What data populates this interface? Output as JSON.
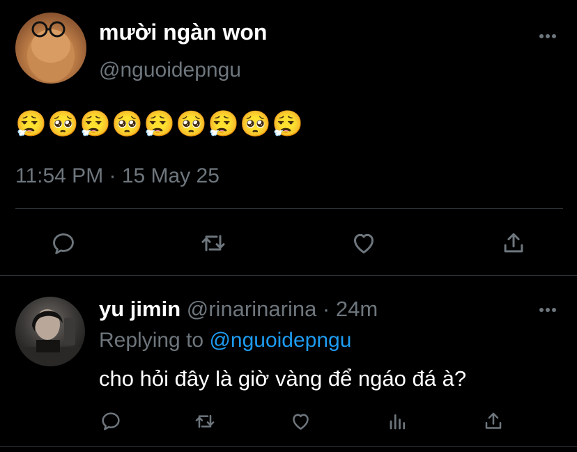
{
  "main_tweet": {
    "author_name": "mười ngàn won",
    "author_handle": "@nguoidepngu",
    "emojis": [
      "😮‍💨",
      "🥺",
      "😮‍💨",
      "🥺",
      "😮‍💨",
      "🥺",
      "😮‍💨",
      "🥺",
      "😮‍💨"
    ],
    "timestamp": "11:54 PM · 15 May 25",
    "actions": [
      "reply-icon",
      "retweet-icon",
      "like-icon",
      "share-icon"
    ]
  },
  "reply_tweet": {
    "author_name": "yu jimin",
    "author_handle": "@rinarinarina",
    "separator": " · ",
    "time_ago": "24m",
    "replying_prefix": "Replying to ",
    "replying_to": "@nguoidepngu",
    "text": "cho hỏi đây là giờ vàng để ngáo đá à?",
    "actions": [
      "reply-icon",
      "retweet-icon",
      "like-icon",
      "analytics-icon",
      "share-icon"
    ]
  },
  "colors": {
    "background": "#000000",
    "primary_text": "#ffffff",
    "secondary_text": "#6e767d",
    "link": "#1d9bf0",
    "divider": "#2f3336",
    "icon": "#6e767d"
  }
}
